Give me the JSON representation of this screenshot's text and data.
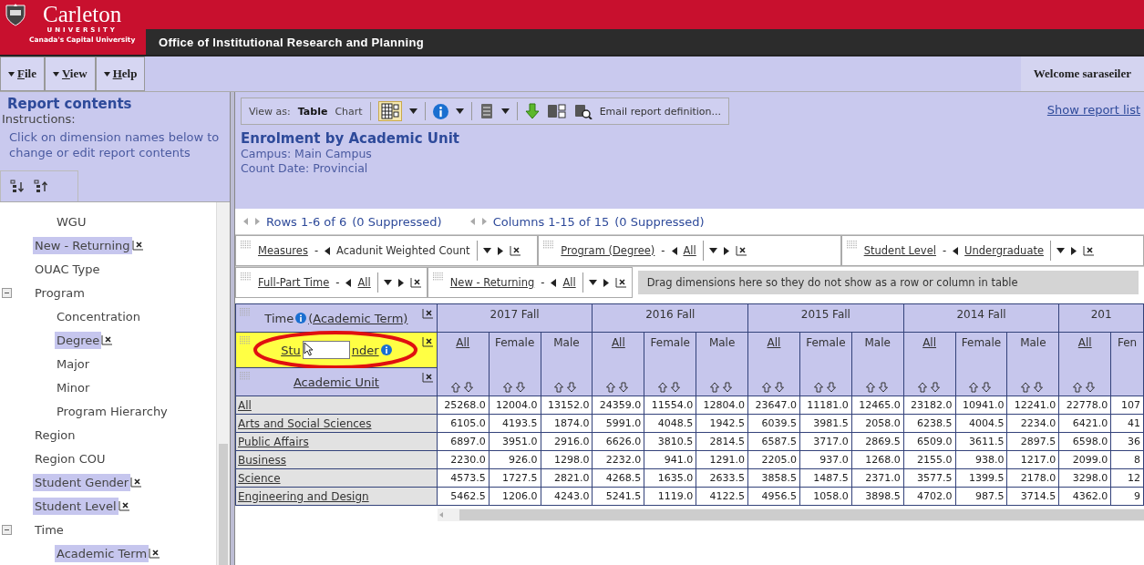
{
  "header": {
    "logo": {
      "name": "Carleton",
      "sub": "UNIVERSITY",
      "tagline": "Canada's Capital University"
    },
    "title": "Office of Institutional Research and Planning"
  },
  "menu": [
    {
      "label": "File"
    },
    {
      "label": "View"
    },
    {
      "label": "Help"
    }
  ],
  "welcome": "Welcome saraseiler",
  "sidebar": {
    "title": "Report contents",
    "instructions_label": "Instructions:",
    "instructions": "Click on dimension names below to change or edit report contents",
    "tree": {
      "continued_children": [
        {
          "label": "WGU",
          "selected": false
        }
      ],
      "items": [
        {
          "label": "New - Returning",
          "selected": true
        },
        {
          "label": "OUAC Type",
          "selected": false
        },
        {
          "label": "Program",
          "selected": false,
          "expanded": true,
          "children": [
            {
              "label": "Concentration",
              "selected": false
            },
            {
              "label": "Degree",
              "selected": true
            },
            {
              "label": "Major",
              "selected": false
            },
            {
              "label": "Minor",
              "selected": false
            },
            {
              "label": "Program Hierarchy",
              "selected": false
            }
          ]
        },
        {
          "label": "Region",
          "selected": false
        },
        {
          "label": "Region COU",
          "selected": false
        },
        {
          "label": "Student Gender",
          "selected": true
        },
        {
          "label": "Student Level",
          "selected": true
        },
        {
          "label": "Time",
          "selected": false,
          "expanded": true,
          "children": [
            {
              "label": "Academic Term",
              "selected": true
            }
          ]
        }
      ]
    }
  },
  "report": {
    "toolbar": {
      "view_as_label": "View as:",
      "views": [
        {
          "label": "Table",
          "selected": true
        },
        {
          "label": "Chart",
          "selected": false
        }
      ],
      "email_label": "Email report definition..."
    },
    "show_report_list": "Show report list",
    "title": "Enrolment by Academic Unit",
    "subtitles": [
      "Campus: Main Campus",
      "Count Date: Provincial"
    ]
  },
  "paging": {
    "rows": "Rows 1-6 of 6",
    "rows_suppressed": "(0 Suppressed)",
    "columns": "Columns 1-15 of 15",
    "columns_suppressed": "(0 Suppressed)"
  },
  "slicers": [
    [
      {
        "dimension": "Measures",
        "separator": "-",
        "value": "Acadunit Weighted Count",
        "kind": "measure"
      },
      {
        "dimension": "Program (Degree)",
        "separator": "-",
        "value": "All",
        "kind": "member"
      },
      {
        "dimension": "Student Level",
        "separator": "-",
        "value": "Undergraduate",
        "kind": "member"
      }
    ],
    [
      {
        "dimension": "Full-Part Time",
        "separator": "-",
        "value": "All",
        "kind": "member"
      },
      {
        "dimension": "New - Returning",
        "separator": "-",
        "value": "All",
        "kind": "member"
      }
    ]
  ],
  "drop_zone": "Drag dimensions here so they do not show as a row or column in table",
  "pivot": {
    "row_header": {
      "time": "Time",
      "time_level": "(Academic Term)",
      "gender_start": "Stu",
      "gender_end": "nder",
      "unit": "Academic Unit"
    },
    "terms": [
      {
        "label": "2017 Fall"
      },
      {
        "label": "2016 Fall"
      },
      {
        "label": "2015 Fall"
      },
      {
        "label": "2014 Fall"
      },
      {
        "label": "201"
      }
    ],
    "subcolumns": [
      {
        "label": "All",
        "kind": "link"
      },
      {
        "label": "Female",
        "kind": "plain"
      },
      {
        "label": "Male",
        "kind": "plain"
      },
      {
        "label": "All",
        "kind": "link"
      },
      {
        "label": "Female",
        "kind": "plain"
      },
      {
        "label": "Male",
        "kind": "plain"
      },
      {
        "label": "All",
        "kind": "link"
      },
      {
        "label": "Female",
        "kind": "plain"
      },
      {
        "label": "Male",
        "kind": "plain"
      },
      {
        "label": "All",
        "kind": "link"
      },
      {
        "label": "Female",
        "kind": "plain"
      },
      {
        "label": "Male",
        "kind": "plain"
      },
      {
        "label": "All",
        "kind": "link"
      },
      {
        "label": "Fen",
        "kind": "plain"
      }
    ],
    "rows": [
      {
        "label": "All",
        "values": [
          "25268.0",
          "12004.0",
          "13152.0",
          "24359.0",
          "11554.0",
          "12804.0",
          "23647.0",
          "11181.0",
          "12465.0",
          "23182.0",
          "10941.0",
          "12241.0",
          "22778.0",
          "107"
        ]
      },
      {
        "label": "Arts and Social Sciences",
        "values": [
          "6105.0",
          "4193.5",
          "1874.0",
          "5991.0",
          "4048.5",
          "1942.5",
          "6039.5",
          "3981.5",
          "2058.0",
          "6238.5",
          "4004.5",
          "2234.0",
          "6421.0",
          "41"
        ]
      },
      {
        "label": "Public Affairs",
        "values": [
          "6897.0",
          "3951.0",
          "2916.0",
          "6626.0",
          "3810.5",
          "2814.5",
          "6587.5",
          "3717.0",
          "2869.5",
          "6509.0",
          "3611.5",
          "2897.5",
          "6598.0",
          "36"
        ]
      },
      {
        "label": "Business",
        "values": [
          "2230.0",
          "926.0",
          "1298.0",
          "2232.0",
          "941.0",
          "1291.0",
          "2205.0",
          "937.0",
          "1268.0",
          "2155.0",
          "938.0",
          "1217.0",
          "2099.0",
          "8"
        ]
      },
      {
        "label": "Science",
        "values": [
          "4573.5",
          "1727.5",
          "2821.0",
          "4268.5",
          "1635.0",
          "2633.5",
          "3858.5",
          "1487.5",
          "2371.0",
          "3577.5",
          "1399.5",
          "2178.0",
          "3298.0",
          "12"
        ]
      },
      {
        "label": "Engineering and Design",
        "values": [
          "5462.5",
          "1206.0",
          "4243.0",
          "5241.5",
          "1119.0",
          "4122.5",
          "4956.5",
          "1058.0",
          "3898.5",
          "4702.0",
          "987.5",
          "3714.5",
          "4362.0",
          "9"
        ]
      }
    ]
  }
}
